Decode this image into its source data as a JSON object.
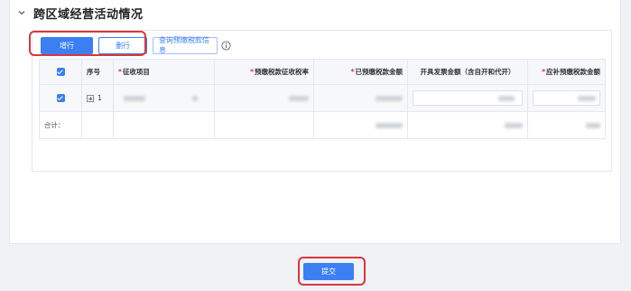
{
  "section": {
    "title": "跨区域经营活动情况",
    "collapse_icon": "chevron-down-icon"
  },
  "toolbar": {
    "add_label": "增行",
    "delete_label": "删行",
    "query_label": "查询预缴税款信息",
    "info_icon": "info-circle-icon"
  },
  "table": {
    "headers": {
      "index": "序号",
      "item": "征收项目",
      "rate": "预缴税款征收税率",
      "paid": "已预缴税款金额",
      "invoice": "开具发票金额（含自开和代开）",
      "supplement": "应补预缴税款金额"
    },
    "required_mark": "*",
    "rows": [
      {
        "index": "1",
        "checked": true
      }
    ],
    "total_label": "合计："
  },
  "footer": {
    "submit_label": "提交"
  },
  "colors": {
    "primary": "#3b7ff3",
    "highlight": "#d9363e",
    "required": "#f03030"
  }
}
